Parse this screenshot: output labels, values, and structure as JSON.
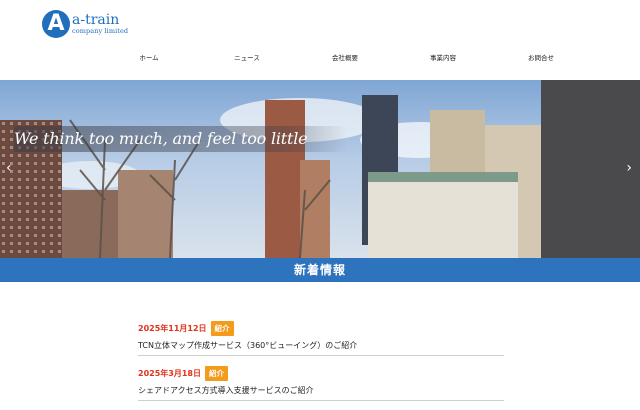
{
  "logo": {
    "mark": "A",
    "name": "a-train",
    "sub": "company limited"
  },
  "nav": [
    {
      "label": "ホーム"
    },
    {
      "label": "ニュース"
    },
    {
      "label": "会社概要"
    },
    {
      "label": "事業内容"
    },
    {
      "label": "お問合せ"
    }
  ],
  "hero": {
    "tagline": "We think too much, and feel too little",
    "prev_icon": "chevron-left-icon",
    "next_icon": "chevron-right-icon",
    "prev_glyph": "‹",
    "next_glyph": "›"
  },
  "section": {
    "title": "新着情報"
  },
  "news": [
    {
      "date": "2025年11月12日",
      "tag": "紹介",
      "title": "TCN立体マップ作成サービス（360°ビューイング）のご紹介"
    },
    {
      "date": "2025年3月18日",
      "tag": "紹介",
      "title": "シェアドアクセス方式導入支援サービスのご紹介"
    }
  ],
  "colors": {
    "brand": "#1f6fbd",
    "section_bar": "#2e73bd",
    "date": "#e0311c",
    "tag": "#f39b1a"
  }
}
